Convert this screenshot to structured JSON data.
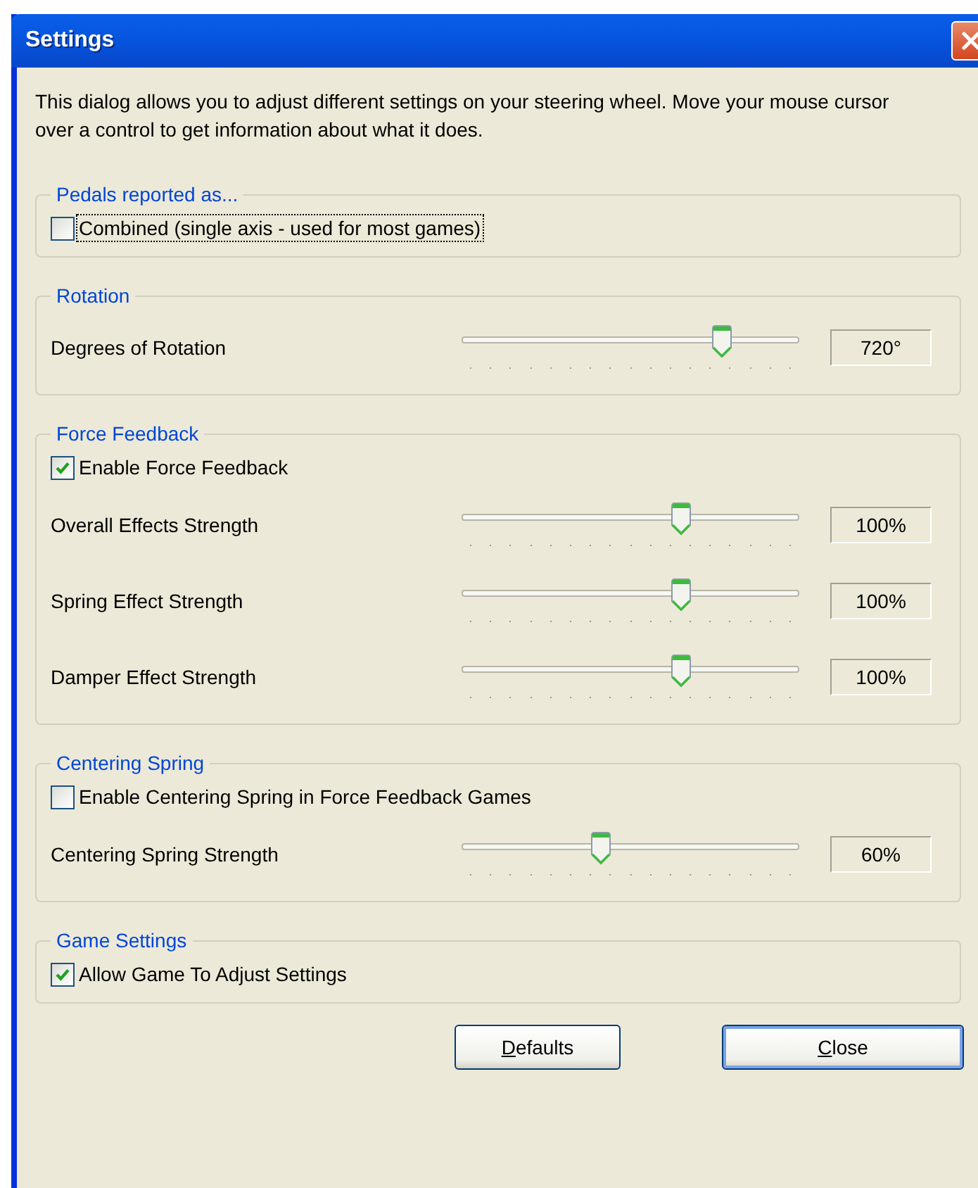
{
  "window": {
    "title": "Settings"
  },
  "description": "This dialog allows you to adjust different settings on your steering wheel.  Move your mouse cursor over a control to get information about what it does.",
  "groups": [
    {
      "title": "Pedals reported as...",
      "items": [
        {
          "kind": "checkbox",
          "label": "Combined (single axis - used for most games)",
          "checked": false,
          "focused": true
        }
      ]
    },
    {
      "title": "Rotation",
      "items": [
        {
          "kind": "slider",
          "label": "Degrees of Rotation",
          "level": 0.775,
          "reading": "720°"
        }
      ]
    },
    {
      "title": "Force Feedback",
      "items": [
        {
          "kind": "checkbox",
          "label": "Enable Force Feedback",
          "checked": true,
          "focused": false
        },
        {
          "kind": "slider",
          "label": "Overall Effects Strength",
          "level": 0.65,
          "reading": "100%"
        },
        {
          "kind": "slider",
          "label": "Spring Effect Strength",
          "level": 0.65,
          "reading": "100%"
        },
        {
          "kind": "slider",
          "label": "Damper Effect Strength",
          "level": 0.65,
          "reading": "100%"
        }
      ]
    },
    {
      "title": "Centering Spring",
      "items": [
        {
          "kind": "checkbox",
          "label": "Enable Centering Spring in Force Feedback Games",
          "checked": false,
          "focused": false
        },
        {
          "kind": "slider",
          "label": "Centering Spring Strength",
          "level": 0.41,
          "reading": "60%"
        }
      ]
    },
    {
      "title": "Game Settings",
      "items": [
        {
          "kind": "checkbox",
          "label": "Allow Game To Adjust Settings",
          "checked": true,
          "focused": false
        }
      ]
    }
  ],
  "buttons": [
    {
      "label": "Defaults",
      "default": false
    },
    {
      "label": "Close",
      "default": true
    }
  ]
}
